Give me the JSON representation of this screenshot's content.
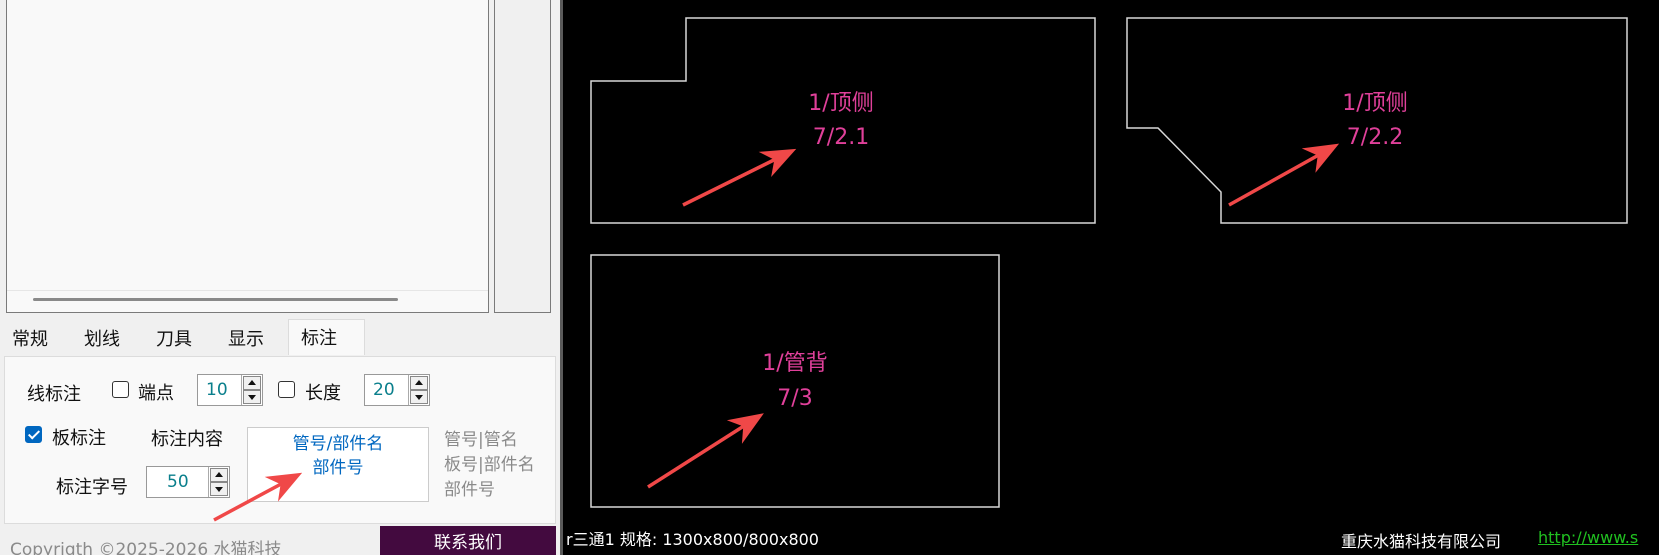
{
  "tabs": [
    {
      "label": "常规"
    },
    {
      "label": "划线"
    },
    {
      "label": "刀具"
    },
    {
      "label": "显示"
    },
    {
      "label": "标注"
    }
  ],
  "active_tab": "标注",
  "annotation": {
    "line_label": "线标注",
    "endpoint_label": "端点",
    "endpoint_checked": false,
    "endpoint_value": "10",
    "length_label": "长度",
    "length_checked": false,
    "length_value": "20",
    "board_label": "板标注",
    "board_checked": true,
    "content_label": "标注内容",
    "content_line1": "管号/部件名",
    "content_line2": "部件号",
    "hint_line1": "管号|管名",
    "hint_line2": "板号|部件名",
    "hint_line3": "部件号",
    "font_size_label": "标注字号",
    "font_size_value": "50"
  },
  "footer": {
    "copyright": "Copyrigth ©2025-2026 水猫科技",
    "contact_button": "联系我们"
  },
  "canvas": {
    "parts": [
      {
        "line1": "1/顶侧",
        "line2": "7/2.1"
      },
      {
        "line1": "1/顶侧",
        "line2": "7/2.2"
      },
      {
        "line1": "1/管背",
        "line2": "7/3"
      }
    ],
    "status_left": "r三通1 规格: 1300x800/800x800",
    "company": "重庆水猫科技有限公司",
    "link": "http://www.s"
  },
  "colors": {
    "canvas_bg": "#000000",
    "label_pink": "#e0409a",
    "arrow_red": "#f04848",
    "link_green": "#20c020",
    "contact_button_bg": "#430a3f",
    "accent_blue": "#0067c0"
  }
}
